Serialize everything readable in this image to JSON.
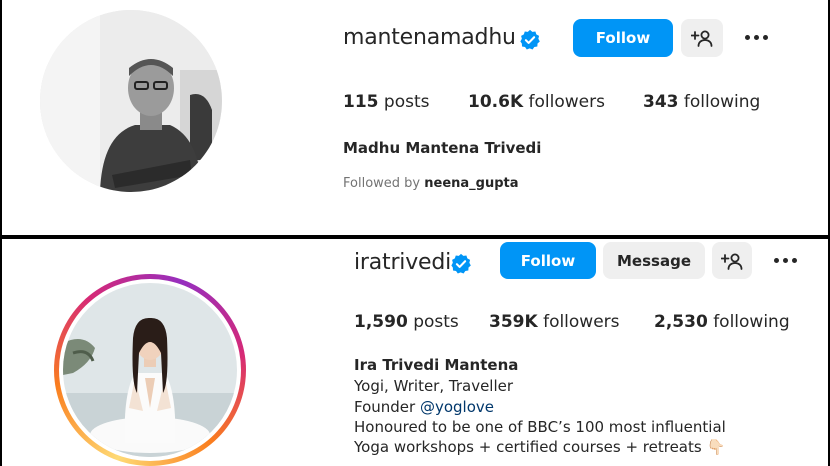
{
  "profile1": {
    "username": "mantenamadhu",
    "follow_label": "Follow",
    "stats": {
      "posts_value": "115",
      "posts_label": "posts",
      "followers_value": "10.6K",
      "followers_label": "followers",
      "following_value": "343",
      "following_label": "following"
    },
    "full_name": "Madhu Mantena Trivedi",
    "followed_by_prefix": "Followed by",
    "followed_by_user": "neena_gupta"
  },
  "profile2": {
    "username": "iratrivedi",
    "follow_label": "Follow",
    "message_label": "Message",
    "stats": {
      "posts_value": "1,590",
      "posts_label": "posts",
      "followers_value": "359K",
      "followers_label": "followers",
      "following_value": "2,530",
      "following_label": "following"
    },
    "full_name": "Ira Trivedi Mantena",
    "bio_line1": "Yogi, Writer, Traveller",
    "bio_founder_prefix": "Founder",
    "bio_founder_handle": "@yoglove",
    "bio_line3": "Honoured to be one of BBC’s 100 most influential",
    "bio_line4": "Yoga workshops + certified courses + retreats 👇🏻"
  },
  "colors": {
    "accent": "#0095f6",
    "verified": "#0095f6",
    "button_grey": "#efefef",
    "muted_text": "#737373",
    "link": "#00376b"
  },
  "icons": [
    "verified-badge-icon",
    "add-person-icon",
    "more-options-icon"
  ]
}
